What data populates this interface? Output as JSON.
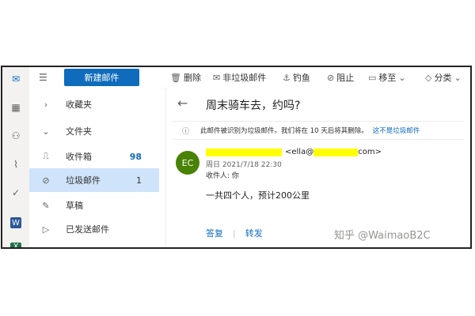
{
  "toolbar": {
    "new_mail": "新建邮件",
    "delete": "删除",
    "junk": "非垃圾邮件",
    "phishing": "钓鱼",
    "block": "阻止",
    "move_to": "移至",
    "categorize": "分类"
  },
  "folders": {
    "favorites": "收藏夹",
    "folders": "文件夹",
    "items": [
      {
        "label": "收件箱",
        "count": "98"
      },
      {
        "label": "垃圾邮件",
        "count": "1"
      },
      {
        "label": "草稿",
        "count": ""
      },
      {
        "label": "已发送邮件",
        "count": ""
      }
    ]
  },
  "message": {
    "subject": "周末骑车去，约吗?",
    "notice_text": "此邮件被识别为垃圾邮件。我们将在 10 天后将其删除。",
    "notice_link": "这不是垃圾邮件",
    "avatar_initials": "EC",
    "sender_prefix": "<ella@",
    "sender_suffix": "com>",
    "date": "周日 2021/7/18 22:30",
    "to": "收件人: 你",
    "body": "一共四个人，预计200公里",
    "reply": "答复",
    "forward": "转发"
  },
  "watermark": "知乎 @WaimaoB2C",
  "colors": {
    "accent": "#0f6cbd",
    "selected_folder": "#cfe4fa",
    "avatar": "#498205",
    "highlight": "#ffff00"
  }
}
